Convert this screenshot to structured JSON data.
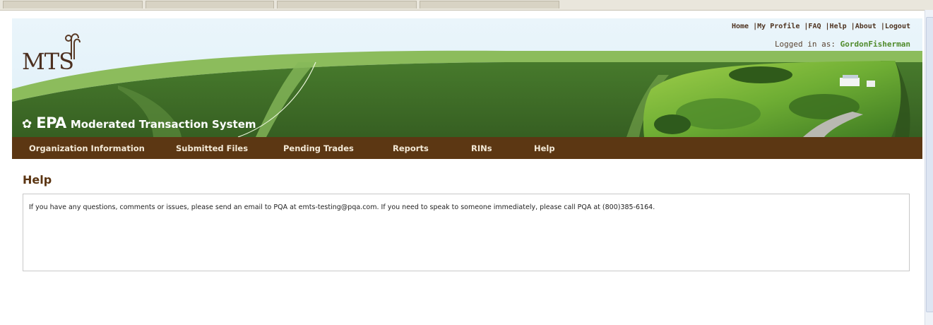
{
  "header": {
    "logo_text": "MTS",
    "epa_mark": "EPA",
    "system_name": "Moderated Transaction System",
    "top_links": [
      "Home",
      "My Profile",
      "FAQ",
      "Help",
      "About",
      "Logout"
    ],
    "logged_in_label": "Logged in as:",
    "logged_in_user": "GordonFisherman"
  },
  "nav": {
    "items": [
      "Organization Information",
      "Submitted Files",
      "Pending Trades",
      "Reports",
      "RINs",
      "Help"
    ]
  },
  "main": {
    "title": "Help",
    "message": "If you have any questions, comments or issues, please send an email to PQA at emts-testing@pqa.com. If you need to speak to someone immediately, please call PQA at (800)385-6164."
  },
  "colors": {
    "banner_green": "#3f6d27",
    "nav_brown": "#5c3713",
    "title_brown": "#5b3512",
    "user_green": "#4f8a2a"
  }
}
